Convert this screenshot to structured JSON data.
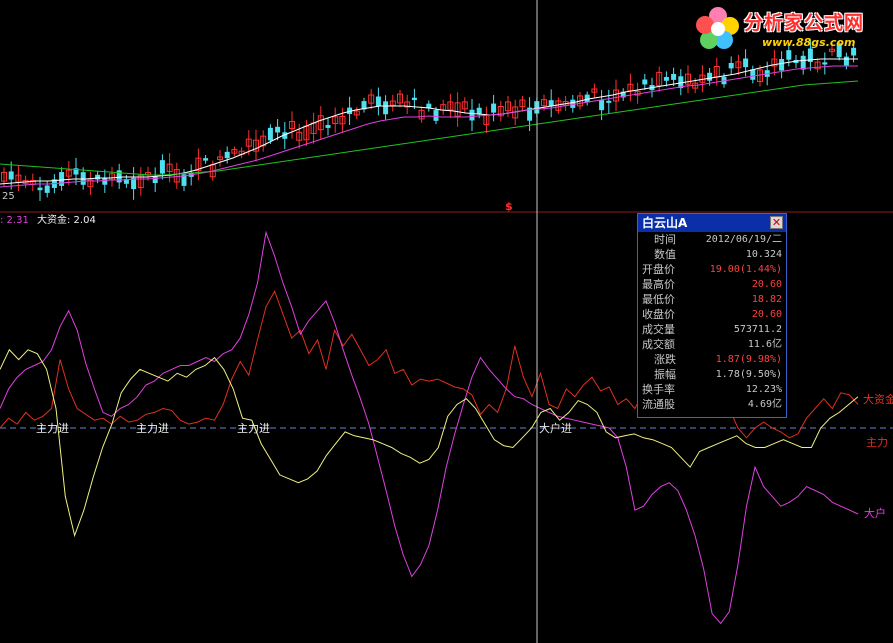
{
  "colors": {
    "background": "#000000",
    "divider": "#8b1a1a",
    "crosshair": "#c8c8c8",
    "bull_candle": "#ff3030",
    "bear_candle": "#4fe0f0",
    "ma_white": "#ffffff",
    "ma_magenta": "#e040e0",
    "ma_green": "#20c020",
    "zhuli": "#e03020",
    "dahu": "#e040e0",
    "dazijin": "#f0f080",
    "dash": "#6a7fd0",
    "label_zhuli": "#f0f0f0",
    "label_dahu": "#e8e8e8"
  },
  "price_panel": {
    "x_tick_label": "25",
    "marker_label": "$"
  },
  "indicator_header": {
    "value_a": ": 2.31",
    "value_b_label": "大资金: 2.04"
  },
  "signal_labels": {
    "zhuli_jin": "主力进",
    "dahu_jin": "大户进"
  },
  "right_edge_labels": {
    "dazijin": "大资金",
    "zhuli": "主力",
    "dahu": "大户"
  },
  "infobox": {
    "title": "白云山A",
    "close_icon": "close-icon",
    "rows": [
      {
        "k": "时间",
        "v": "2012/06/19/二",
        "indent": true,
        "color": "#c8c8c8"
      },
      {
        "k": "数值",
        "v": "10.324",
        "indent": true,
        "color": "#c8c8c8"
      },
      {
        "k": "开盘价",
        "v": "19.00(1.44%)",
        "indent": false,
        "color": "#ff4040"
      },
      {
        "k": "最高价",
        "v": "20.60",
        "indent": false,
        "color": "#ff4040"
      },
      {
        "k": "最低价",
        "v": "18.82",
        "indent": false,
        "color": "#ff4040"
      },
      {
        "k": "收盘价",
        "v": "20.60",
        "indent": false,
        "color": "#ff4040"
      },
      {
        "k": "成交量",
        "v": "573711.2",
        "indent": false,
        "color": "#c8c8c8"
      },
      {
        "k": "成交额",
        "v": "11.6亿",
        "indent": false,
        "color": "#c8c8c8"
      },
      {
        "k": "涨跌",
        "v": "1.87(9.98%)",
        "indent": true,
        "color": "#ff4040"
      },
      {
        "k": "振幅",
        "v": "1.78(9.50%)",
        "indent": true,
        "color": "#c8c8c8"
      },
      {
        "k": "换手率",
        "v": "12.23%",
        "indent": false,
        "color": "#c8c8c8"
      },
      {
        "k": "流通股",
        "v": "4.69亿",
        "indent": false,
        "color": "#c8c8c8"
      }
    ]
  },
  "logo": {
    "text": "分析家公式网",
    "url_text": "www.88gs.com"
  },
  "chart_data": [
    {
      "type": "line",
      "title": "",
      "series": [
        {
          "values": [
            184,
            183,
            182,
            181,
            181,
            180,
            179,
            179,
            178,
            178,
            177,
            177,
            177,
            176,
            175,
            173,
            170,
            166,
            162,
            158,
            153,
            148,
            142,
            136,
            131,
            126,
            121,
            117,
            113,
            110,
            108,
            106,
            106,
            106,
            107,
            108,
            110,
            111,
            113,
            114,
            115,
            114,
            112,
            110,
            108,
            106,
            104,
            102,
            99,
            97,
            95,
            92,
            90,
            88,
            86,
            84,
            82,
            80,
            78,
            76,
            74,
            71,
            68,
            65,
            63,
            61,
            60,
            59,
            59,
            59,
            59
          ]
        },
        {
          "values": [
            187,
            186,
            185,
            184,
            184,
            183,
            182,
            181,
            181,
            180,
            180,
            179,
            179,
            178,
            177,
            176,
            174,
            172,
            169,
            166,
            163,
            160,
            156,
            152,
            148,
            144,
            140,
            136,
            132,
            128,
            124,
            121,
            119,
            117,
            117,
            116,
            117,
            117,
            117,
            116,
            115,
            114,
            112,
            110,
            109,
            108,
            106,
            104,
            102,
            100,
            98,
            96,
            94,
            92,
            90,
            88,
            86,
            85,
            83,
            81,
            79,
            77,
            75,
            73,
            71,
            69,
            68,
            67,
            66,
            66,
            66
          ]
        },
        {
          "values": [
            164,
            165,
            166,
            167,
            168,
            169,
            170,
            171,
            172,
            173,
            174,
            175,
            175,
            174,
            173,
            172,
            171,
            169,
            167,
            165,
            163,
            161,
            159,
            157,
            155,
            153,
            151,
            149,
            147,
            145,
            143,
            141,
            139,
            137,
            135,
            133,
            131,
            129,
            127,
            125,
            123,
            121,
            119,
            117,
            115,
            113,
            111,
            109,
            107,
            105,
            103,
            101,
            99,
            97,
            95,
            93,
            91,
            89,
            87,
            85,
            84,
            83,
            82,
            81
          ]
        }
      ]
    },
    {
      "type": "line",
      "title": "",
      "series": [
        {
          "name": "主力",
          "values": [
            0.0,
            0.5,
            0.2,
            0.8,
            0.4,
            0.6,
            1.0,
            3.5,
            2.0,
            1.0,
            0.7,
            0.4,
            0.5,
            0.2,
            0.6,
            0.3,
            0.4,
            0.7,
            0.8,
            1.0,
            0.9,
            0.4,
            0.2,
            0.3,
            0.5,
            0.4,
            1.2,
            2.5,
            3.4,
            2.7,
            4.5,
            6.2,
            7.0,
            5.8,
            4.6,
            5.0,
            3.8,
            4.5,
            3.0,
            5.0,
            4.2,
            4.8,
            4.0,
            3.2,
            3.5,
            4.0,
            2.8,
            3.0,
            2.2,
            2.5,
            2.4,
            2.5,
            2.3,
            2.1,
            2.0,
            1.7,
            0.7,
            1.2,
            0.8,
            2.0,
            4.2,
            2.6,
            1.6,
            2.8,
            1.2,
            1.0,
            2.0,
            1.6,
            2.2,
            2.6,
            1.9,
            2.1,
            1.2,
            1.5,
            1.0,
            1.8,
            1.6,
            0.8,
            1.1,
            1.7,
            1.9,
            1.4,
            0.8,
            0.9,
            1.2,
            1.0,
            0.0,
            -0.5,
            0.0,
            0.3,
            0.0,
            -0.2,
            -0.5,
            -0.3,
            0.5,
            1.0,
            1.5,
            1.0,
            1.8,
            1.7,
            1.2
          ]
        },
        {
          "name": "大户",
          "values": [
            1.0,
            2.0,
            2.6,
            3.0,
            3.2,
            3.4,
            4.0,
            5.2,
            6.0,
            5.0,
            3.3,
            2.0,
            0.8,
            0.6,
            1.0,
            1.2,
            1.6,
            2.2,
            2.4,
            2.8,
            3.0,
            3.2,
            3.2,
            3.4,
            3.6,
            3.4,
            3.8,
            4.0,
            4.6,
            5.8,
            7.4,
            10.0,
            8.8,
            7.4,
            6.2,
            4.8,
            5.5,
            6.0,
            6.5,
            5.4,
            4.0,
            2.7,
            1.5,
            0.2,
            -1.5,
            -3.2,
            -5.0,
            -6.5,
            -7.6,
            -7.0,
            -6.0,
            -4.2,
            -2.0,
            -0.3,
            1.2,
            2.6,
            3.6,
            3.0,
            2.5,
            2.0,
            1.6,
            1.5,
            1.2,
            1.0,
            0.8,
            0.6,
            0.5,
            0.4,
            0.3,
            0.2,
            0.1,
            0.0,
            -0.5,
            -2.0,
            -4.2,
            -4.0,
            -3.4,
            -3.0,
            -2.8,
            -3.2,
            -4.2,
            -5.5,
            -7.2,
            -9.5,
            -10.0,
            -9.4,
            -7.0,
            -4.0,
            -2.0,
            -3.0,
            -3.5,
            -4.0,
            -3.8,
            -3.5,
            -3.0,
            -3.2,
            -3.4,
            -3.8,
            -4.0,
            -4.2,
            -4.4
          ]
        },
        {
          "name": "大资金",
          "values": [
            3.0,
            4.0,
            3.5,
            4.0,
            3.8,
            3.0,
            1.0,
            -3.5,
            -5.5,
            -4.2,
            -2.5,
            -1.0,
            0.2,
            1.8,
            2.5,
            3.0,
            2.8,
            2.6,
            2.4,
            2.8,
            2.6,
            3.0,
            3.2,
            3.6,
            3.0,
            2.0,
            0.5,
            0.4,
            -0.8,
            -1.6,
            -2.4,
            -2.6,
            -2.8,
            -2.6,
            -2.2,
            -1.4,
            -0.8,
            -0.2,
            -0.4,
            -0.5,
            -0.6,
            -0.8,
            -1.0,
            -1.3,
            -1.5,
            -1.8,
            -1.6,
            -1.0,
            0.6,
            1.2,
            1.5,
            1.0,
            0.2,
            -0.6,
            -0.9,
            -1.0,
            -0.5,
            0.0,
            0.8,
            1.0,
            0.4,
            0.8,
            1.4,
            1.2,
            0.8,
            -0.2,
            -0.5,
            -0.4,
            -0.3,
            -0.5,
            -0.6,
            -0.8,
            -1.0,
            -1.5,
            -2.0,
            -1.2,
            -1.0,
            -0.8,
            -0.6,
            -0.4,
            -0.8,
            -1.0,
            -1.0,
            -0.8,
            -0.6,
            -0.8,
            -1.0,
            -1.0,
            0.0,
            0.5,
            0.8,
            1.2,
            1.6
          ]
        }
      ],
      "ylim": [
        -11,
        11
      ]
    }
  ]
}
